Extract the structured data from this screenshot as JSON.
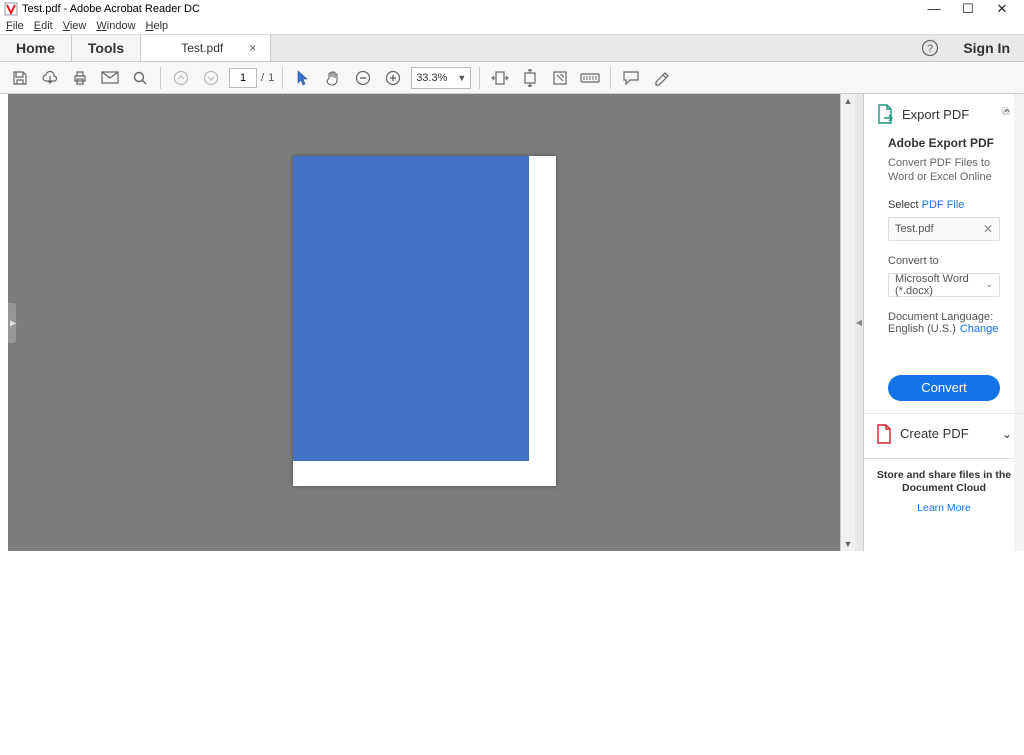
{
  "titlebar": {
    "title": "Test.pdf - Adobe Acrobat Reader DC"
  },
  "menubar": {
    "file": "File",
    "edit": "Edit",
    "view": "View",
    "window": "Window",
    "help": "Help"
  },
  "tabs": {
    "home": "Home",
    "tools": "Tools",
    "file": "Test.pdf",
    "signin": "Sign In"
  },
  "toolbar": {
    "page_current": "1",
    "page_sep": "/",
    "page_total": "1",
    "zoom": "33.3%"
  },
  "rightpanel": {
    "export": {
      "title": "Export PDF",
      "heading": "Adobe Export PDF",
      "desc": "Convert PDF Files to Word or Excel Online",
      "select_prefix": "Select ",
      "select_link": "PDF File",
      "selected_file": "Test.pdf",
      "convert_to_label": "Convert to",
      "convert_to_value": "Microsoft Word (*.docx)",
      "lang_label": "Document Language:",
      "lang_value": "English (U.S.)",
      "lang_change": "Change",
      "convert_btn": "Convert"
    },
    "create": {
      "title": "Create PDF"
    },
    "promo": {
      "text": "Store and share files in the Document Cloud",
      "learn": "Learn More"
    }
  }
}
